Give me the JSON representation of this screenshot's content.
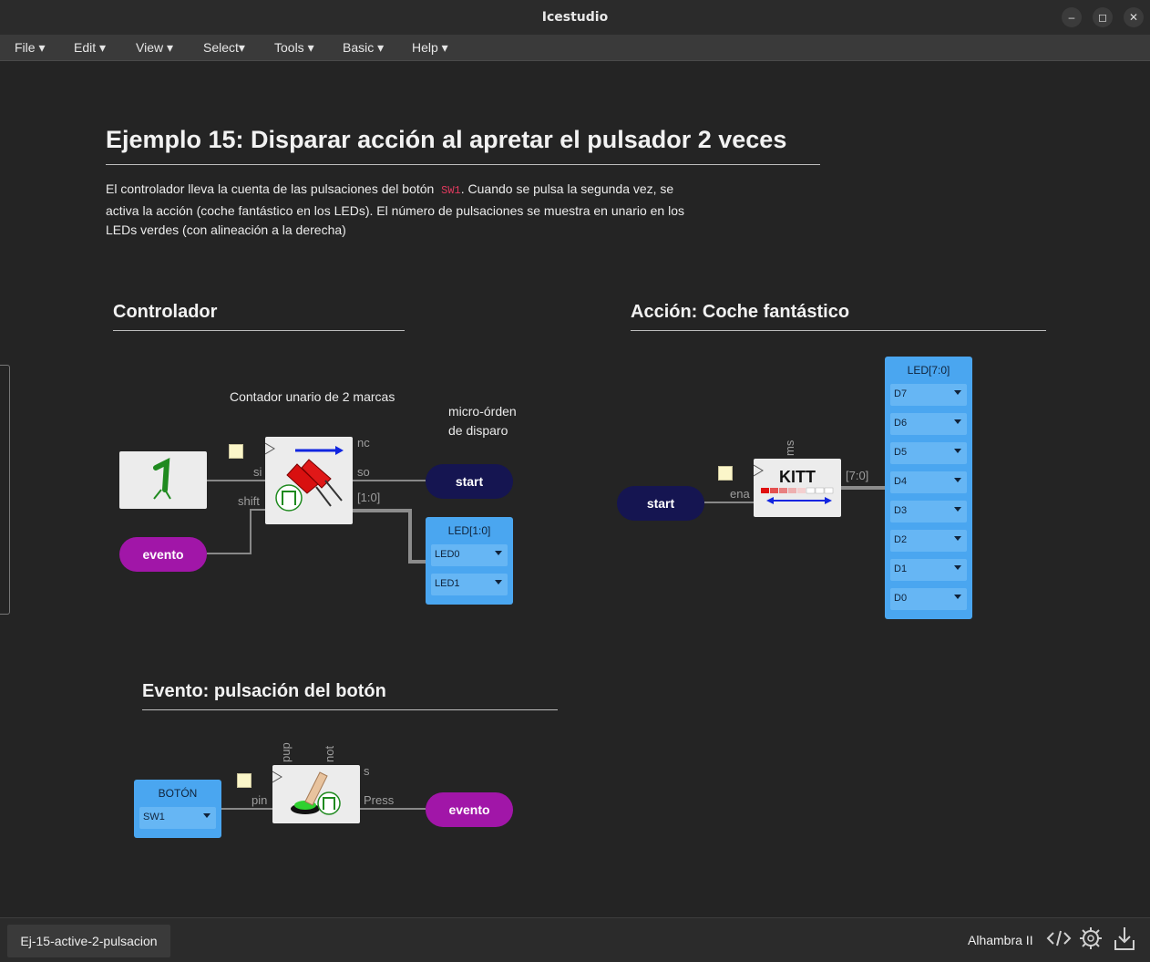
{
  "window": {
    "title": "Icestudio"
  },
  "menu": [
    "File",
    "Edit",
    "View",
    "Select",
    "Tools",
    "Basic",
    "Help"
  ],
  "doc": {
    "title": "Ejemplo 15: Disparar acción al apretar el pulsador 2 veces",
    "para_1": "El controlador lleva la cuenta de las pulsaciones del botón",
    "para_code": "SW1",
    "para_2": ". Cuando se pulsa la segunda vez, se activa la acción (coche fantástico en los LEDs). El número de pulsaciones se muestra en unario en los LEDs verdes (con alineación a la derecha)"
  },
  "controlador": {
    "heading": "Controlador",
    "comment_counter": "Contador unario de 2 marcas",
    "comment_order_1": "micro-órden",
    "comment_order_2": "de disparo",
    "ports": {
      "si": "si",
      "shift": "shift",
      "nc": "nc",
      "so": "so",
      "bus": "[1:0]"
    },
    "start_label": "start",
    "evento_label": "evento",
    "led_block": {
      "title": "LED[1:0]",
      "items": [
        "LED0",
        "LED1"
      ]
    }
  },
  "accion": {
    "heading": "Acción: Coche fantástico",
    "start_label": "start",
    "kitt_label": "KITT",
    "ports": {
      "ms": "ms",
      "ena": "ena",
      "bus": "[7:0]"
    },
    "led_block": {
      "title": "LED[7:0]",
      "items": [
        "D7",
        "D6",
        "D5",
        "D4",
        "D3",
        "D2",
        "D1",
        "D0"
      ]
    }
  },
  "evento": {
    "heading": "Evento: pulsación del botón",
    "boton_block": {
      "title": "BOTÓN",
      "value": "SW1"
    },
    "ports": {
      "pup": "pup",
      "not": "not",
      "s": "s",
      "pin": "pin",
      "press": "Press"
    },
    "evento_label": "evento"
  },
  "status": {
    "file_tab": "Ej-15-active-2-pulsacion",
    "board": "Alhambra II"
  },
  "icons": [
    "minimize-icon",
    "maximize-icon",
    "close-icon",
    "code-icon",
    "settings-gear-icon",
    "download-icon"
  ]
}
